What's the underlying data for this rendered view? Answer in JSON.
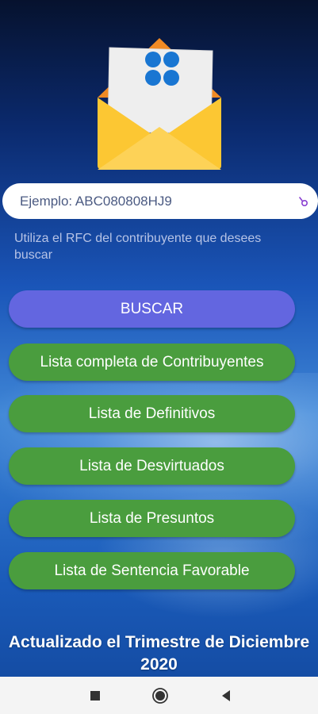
{
  "search": {
    "placeholder": "Ejemplo: ABC080808HJ9",
    "hint": "Utiliza el RFC del contribuyente que desees buscar"
  },
  "buttons": {
    "search": "BUSCAR",
    "list_complete": "Lista completa de Contribuyentes",
    "list_definitive": "Lista de Definitivos",
    "list_disproved": "Lista de Desvirtuados",
    "list_presumed": "Lista de Presuntos",
    "list_favorable": "Lista de Sentencia Favorable"
  },
  "footer": {
    "line1": "Actualizado el Trimestre de Diciembre",
    "line2": "2020"
  },
  "colors": {
    "search_button": "#6366e0",
    "list_button": "#4a9d3e",
    "envelope": "#fbbd1e",
    "logo_dots": "#1976d2"
  },
  "icons": {
    "logo": "envelope-icon",
    "field": "clear-icon",
    "nav": [
      "recents-icon",
      "home-icon",
      "back-icon"
    ]
  }
}
